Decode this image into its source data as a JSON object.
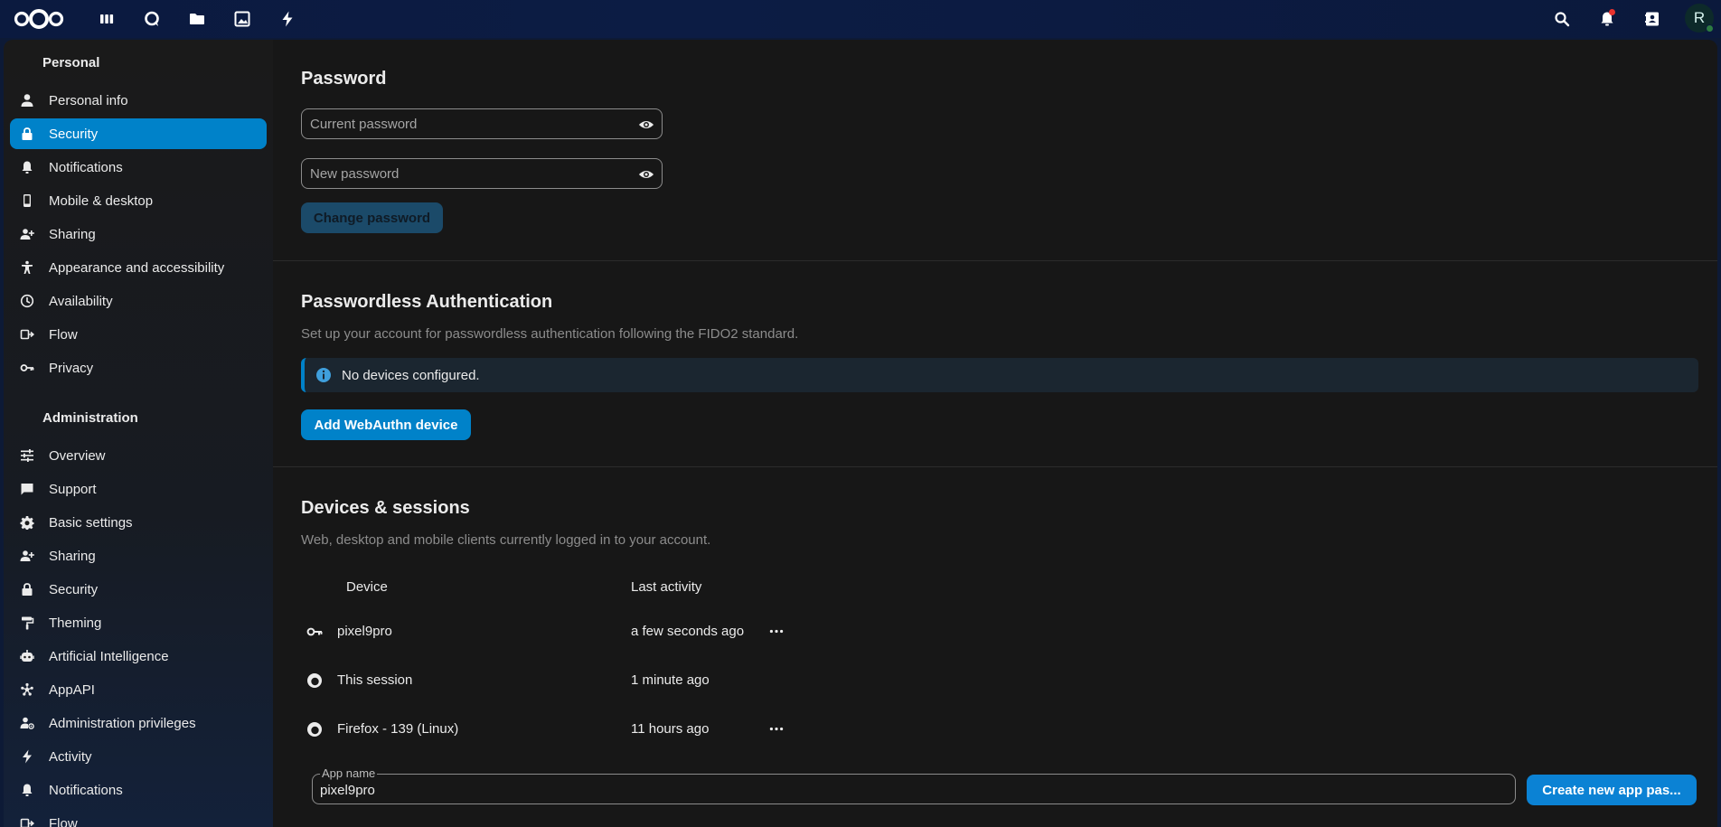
{
  "header": {
    "apps": [
      {
        "name": "dashboard-app",
        "icon": "dashboard-icon"
      },
      {
        "name": "search-app",
        "icon": "talk-icon"
      },
      {
        "name": "files-app",
        "icon": "folder-icon"
      },
      {
        "name": "photos-app",
        "icon": "image-icon"
      },
      {
        "name": "activity-app",
        "icon": "lightning-icon"
      }
    ],
    "avatar_initial": "R"
  },
  "sidebar": {
    "personal_heading": "Personal",
    "personal_items": [
      {
        "label": "Personal info",
        "icon": "user-icon",
        "active": false
      },
      {
        "label": "Security",
        "icon": "lock-icon",
        "active": true
      },
      {
        "label": "Notifications",
        "icon": "bell-icon",
        "active": false
      },
      {
        "label": "Mobile & desktop",
        "icon": "phone-icon",
        "active": false
      },
      {
        "label": "Sharing",
        "icon": "share-user-icon",
        "active": false
      },
      {
        "label": "Appearance and accessibility",
        "icon": "accessibility-icon",
        "active": false
      },
      {
        "label": "Availability",
        "icon": "clock-icon",
        "active": false
      },
      {
        "label": "Flow",
        "icon": "flow-icon",
        "active": false
      },
      {
        "label": "Privacy",
        "icon": "key-icon",
        "active": false
      }
    ],
    "admin_heading": "Administration",
    "admin_items": [
      {
        "label": "Overview",
        "icon": "tune-icon"
      },
      {
        "label": "Support",
        "icon": "chat-icon"
      },
      {
        "label": "Basic settings",
        "icon": "gear-icon"
      },
      {
        "label": "Sharing",
        "icon": "share-user-icon"
      },
      {
        "label": "Security",
        "icon": "lock-icon"
      },
      {
        "label": "Theming",
        "icon": "paint-roller-icon"
      },
      {
        "label": "Artificial Intelligence",
        "icon": "robot-icon"
      },
      {
        "label": "AppAPI",
        "icon": "appapi-icon"
      },
      {
        "label": "Administration privileges",
        "icon": "admin-user-icon"
      },
      {
        "label": "Activity",
        "icon": "lightning-icon"
      },
      {
        "label": "Notifications",
        "icon": "bell-icon"
      },
      {
        "label": "Flow",
        "icon": "flow-icon"
      }
    ]
  },
  "password": {
    "title": "Password",
    "current_placeholder": "Current password",
    "new_placeholder": "New password",
    "change_button": "Change password"
  },
  "passwordless": {
    "title": "Passwordless Authentication",
    "description": "Set up your account for passwordless authentication following the FIDO2 standard.",
    "notice": "No devices configured.",
    "add_button": "Add WebAuthn device"
  },
  "devices": {
    "title": "Devices & sessions",
    "description": "Web, desktop and mobile clients currently logged in to your account.",
    "col_device": "Device",
    "col_activity": "Last activity",
    "rows": [
      {
        "device": "pixel9pro",
        "activity": "a few seconds ago",
        "icon": "key-icon",
        "has_menu": true
      },
      {
        "device": "This session",
        "activity": "1 minute ago",
        "icon": "firefox-icon",
        "has_menu": false
      },
      {
        "device": "Firefox - 139 (Linux)",
        "activity": "11 hours ago",
        "icon": "firefox-icon",
        "has_menu": true
      }
    ],
    "app_name_label": "App name",
    "app_name_value": "pixel9pro",
    "create_button": "Create new app pas..."
  },
  "colors": {
    "accent": "#0082c9",
    "background": "#171717",
    "header": "#0b1a3f"
  }
}
